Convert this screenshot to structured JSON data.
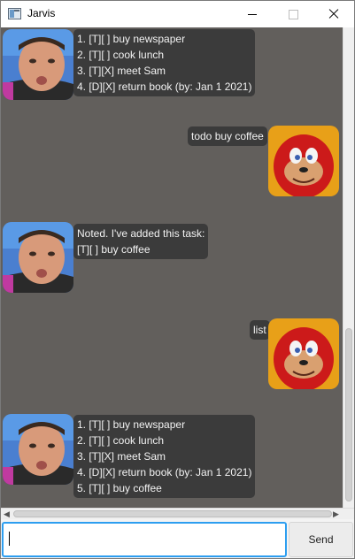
{
  "window": {
    "title": "Jarvis",
    "icon": "app-window-icon"
  },
  "messages": [
    {
      "sender": "bot",
      "lines": [
        "1. [T][ ] buy newspaper",
        "2. [T][ ] cook lunch",
        "3. [T][X] meet Sam",
        "4. [D][X] return book (by: Jan 1 2021)"
      ]
    },
    {
      "sender": "user",
      "lines": [
        "todo buy coffee"
      ]
    },
    {
      "sender": "bot",
      "lines": [
        "Noted. I've added this task:",
        "[T][ ] buy coffee"
      ]
    },
    {
      "sender": "user",
      "lines": [
        "list"
      ]
    },
    {
      "sender": "bot",
      "lines": [
        "1. [T][ ] buy newspaper",
        "2. [T][ ] cook lunch",
        "3. [T][X] meet Sam",
        "4. [D][X] return book (by: Jan 1 2021)",
        "5. [T][ ] buy coffee"
      ]
    }
  ],
  "input": {
    "value": "",
    "placeholder": ""
  },
  "send_button": {
    "label": "Send"
  },
  "colors": {
    "chat_background": "#625f5c",
    "bubble_background": "#3b3b3b",
    "bubble_text": "#f2f2f2",
    "input_focus_border": "#2d9ef0"
  }
}
